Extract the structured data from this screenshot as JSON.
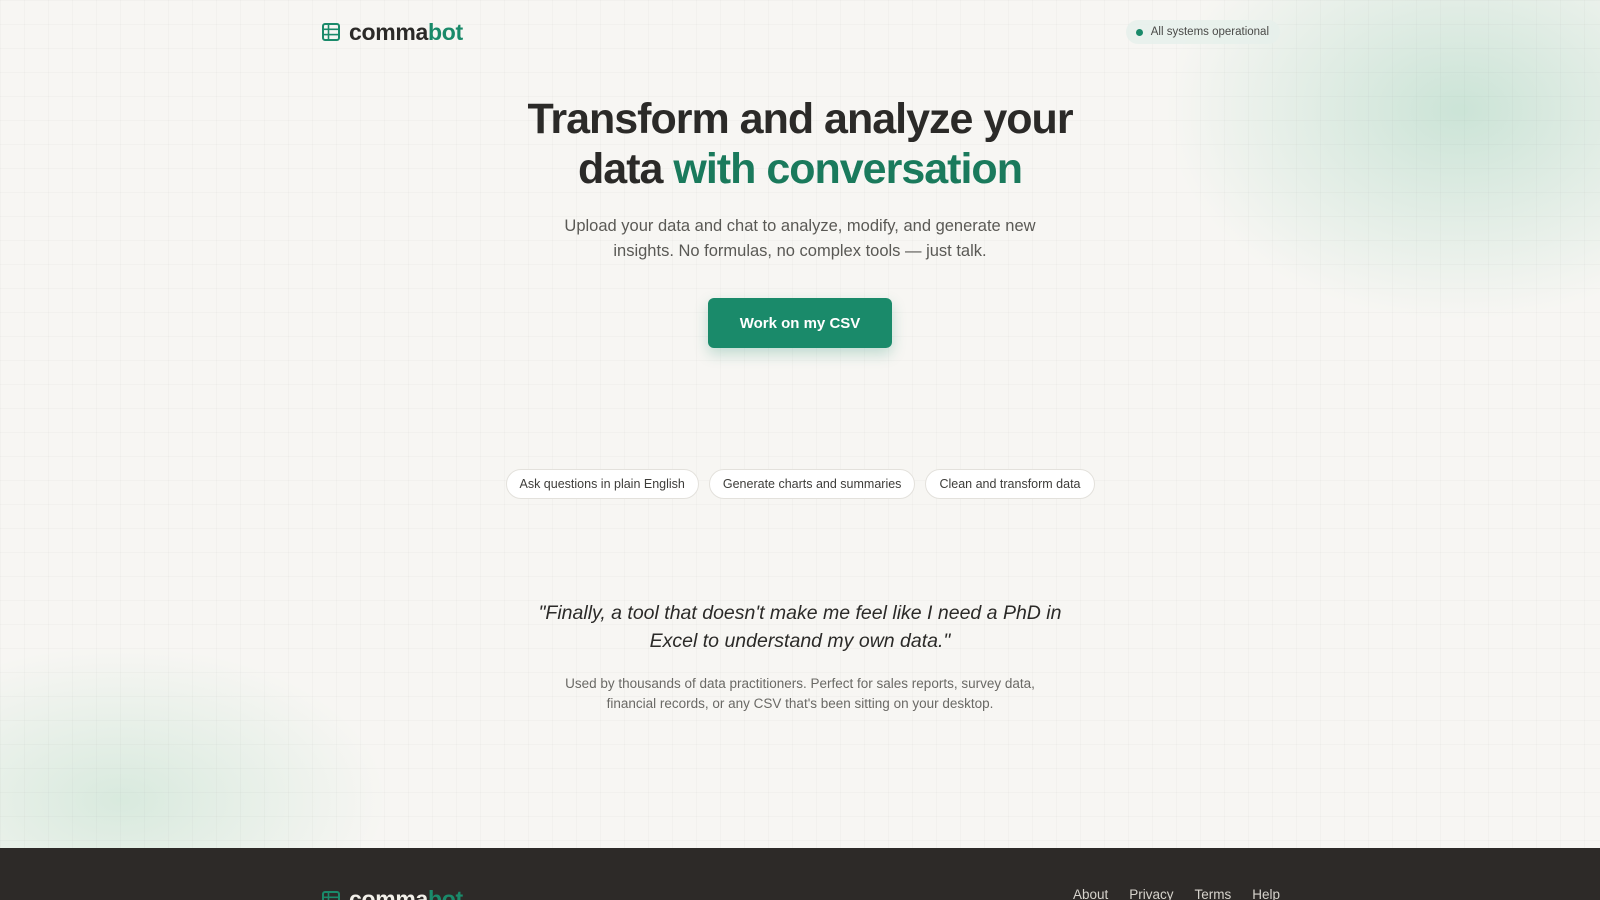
{
  "brand": {
    "name_primary": "comma",
    "name_accent": "bot",
    "icon": "spreadsheet-icon",
    "accent_color": "#1a8a6a"
  },
  "status": {
    "label": "All systems operational",
    "color": "#1a8a6a"
  },
  "hero": {
    "title_line1": "Transform and analyze your",
    "title_line2_plain": "data ",
    "title_line2_accent": "with conversation",
    "subtitle": "Upload your data and chat to analyze, modify, and generate new insights. No formulas, no complex tools — just talk.",
    "cta_label": "Work on my CSV"
  },
  "features": [
    {
      "label": "Ask questions in plain English"
    },
    {
      "label": "Generate charts and summaries"
    },
    {
      "label": "Clean and transform data"
    }
  ],
  "testimonial": {
    "quote": "\"Finally, a tool that doesn't make me feel like I need a PhD in Excel to understand my own data.\"",
    "subtext": "Used by thousands of data practitioners. Perfect for sales reports, survey data, financial records, or any CSV that's been sitting on your desktop."
  },
  "footer": {
    "links": [
      {
        "label": "About"
      },
      {
        "label": "Privacy"
      },
      {
        "label": "Terms"
      },
      {
        "label": "Help"
      }
    ]
  }
}
